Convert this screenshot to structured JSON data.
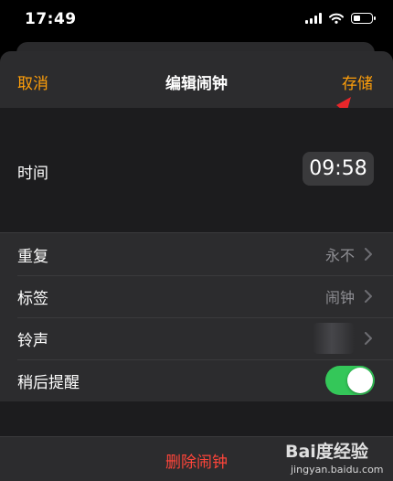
{
  "status_bar": {
    "time": "17:49",
    "battery_level": 0.4
  },
  "nav": {
    "cancel_label": "取消",
    "title": "编辑闹钟",
    "save_label": "存储"
  },
  "time_row": {
    "label": "时间",
    "value": "09:58"
  },
  "rows": [
    {
      "label": "重复",
      "value": "永不"
    },
    {
      "label": "标签",
      "value": "闹钟"
    },
    {
      "label": "铃声",
      "value": ""
    },
    {
      "label": "稍后提醒",
      "toggle_on": true
    }
  ],
  "delete_label": "删除闹钟",
  "accent_color": "#ff9f0a",
  "destructive_color": "#ff453a",
  "toggle_color": "#34c759",
  "annotation_arrow_color": "#e8262a",
  "watermark": {
    "brand": "Bai度经验",
    "url": "jingyan.baidu.com"
  }
}
